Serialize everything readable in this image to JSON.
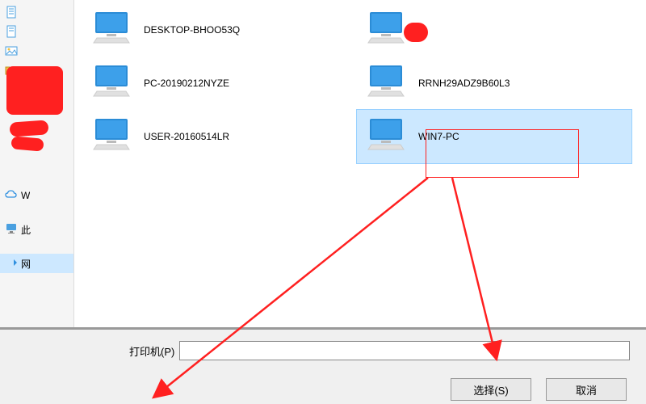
{
  "sidebar": {
    "items": [
      {
        "label": ""
      },
      {
        "label": ""
      },
      {
        "label": ""
      },
      {
        "label": ""
      },
      {
        "label": "W"
      },
      {
        "label": "此"
      },
      {
        "label": "网"
      }
    ]
  },
  "files": {
    "col1": [
      {
        "name": "DESKTOP-BHOO53Q"
      },
      {
        "name": "PC-20190212NYZE"
      },
      {
        "name": "USER-20160514LR"
      }
    ],
    "col2": [
      {
        "name": ""
      },
      {
        "name": "RRNH29ADZ9B60L3"
      },
      {
        "name": "WIN7-PC"
      }
    ]
  },
  "form": {
    "printer_label": "打印机(P)",
    "printer_value": ""
  },
  "buttons": {
    "select": "选择(S)",
    "cancel": "取消"
  }
}
